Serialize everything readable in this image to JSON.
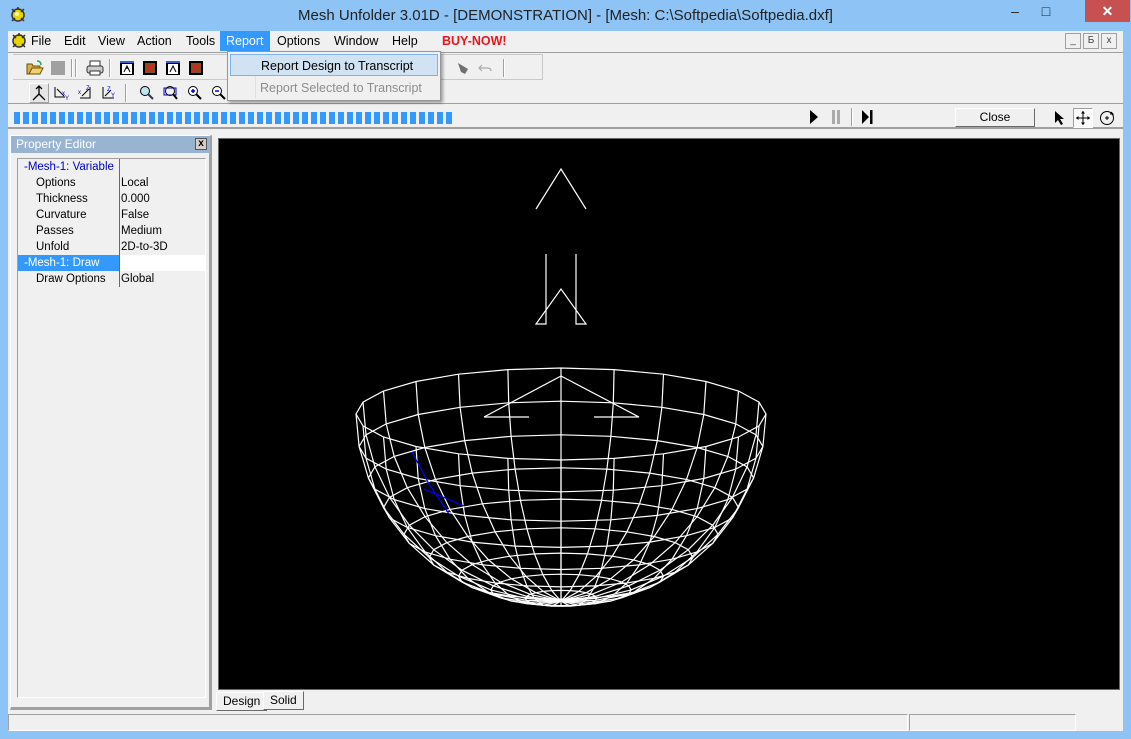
{
  "window": {
    "title": "Mesh Unfolder 3.01D - [DEMONSTRATION] - [Mesh: C:\\Softpedia\\Softpedia.dxf]",
    "minimize_glyph": "–",
    "maximize_glyph": "□",
    "close_glyph": "✕"
  },
  "menubar": {
    "items": [
      {
        "label": "File"
      },
      {
        "label": "Edit"
      },
      {
        "label": "View"
      },
      {
        "label": "Action"
      },
      {
        "label": "Tools"
      },
      {
        "label": "Report",
        "active": true
      },
      {
        "label": "Options"
      },
      {
        "label": "Window"
      },
      {
        "label": "Help"
      },
      {
        "label": "BUY-NOW!"
      }
    ],
    "mdi_buttons": [
      "_",
      "Б",
      "x"
    ]
  },
  "report_menu": {
    "items": [
      {
        "label": "Report Design to Transcript",
        "highlighted": true,
        "enabled": true
      },
      {
        "label": "Report Selected to Transcript",
        "highlighted": false,
        "enabled": false
      }
    ]
  },
  "toolbar": {
    "row1": [
      "open-icon",
      "save-icon",
      "print-icon",
      "export-dxf-icon",
      "export-dxf-delete-icon",
      "export-icon",
      "export-delete-icon"
    ],
    "row2": [
      "view-3d-icon",
      "view-xy-icon",
      "view-xz-icon",
      "view-zy-icon",
      "zoom-icon",
      "zoom-window-icon",
      "zoom-in-icon",
      "zoom-out-icon"
    ]
  },
  "animation": {
    "progress_percent": 100,
    "close_label": "Close",
    "tools": [
      "select-arrow-icon",
      "pan-move-icon",
      "rotate-icon"
    ],
    "active_tool": "pan-move-icon"
  },
  "property_editor": {
    "title": "Property Editor",
    "close_glyph": "x",
    "rows": [
      {
        "key": "-Mesh-1: Variable",
        "value": "",
        "group": true
      },
      {
        "key": "Options",
        "value": "Local"
      },
      {
        "key": "Thickness",
        "value": "0.000"
      },
      {
        "key": "Curvature",
        "value": "False"
      },
      {
        "key": "Passes",
        "value": "Medium"
      },
      {
        "key": "Unfold",
        "value": "2D-to-3D"
      },
      {
        "key": "-Mesh-1: Draw",
        "value": "",
        "group": true,
        "selected": true
      },
      {
        "key": "Draw Options",
        "value": "Global"
      }
    ]
  },
  "viewport": {
    "background": "#000000",
    "mesh_color": "#ffffff",
    "highlight_color": "#0000ff",
    "object": "hemisphere wireframe mesh"
  },
  "view_tabs": [
    {
      "label": "Design",
      "active": true
    },
    {
      "label": "Solid",
      "active": false
    }
  ],
  "colors": {
    "accent": "#3399ff",
    "buy_now": "#e8161c",
    "title_bar": "#8ec3f5",
    "close_button": "#c75050"
  }
}
